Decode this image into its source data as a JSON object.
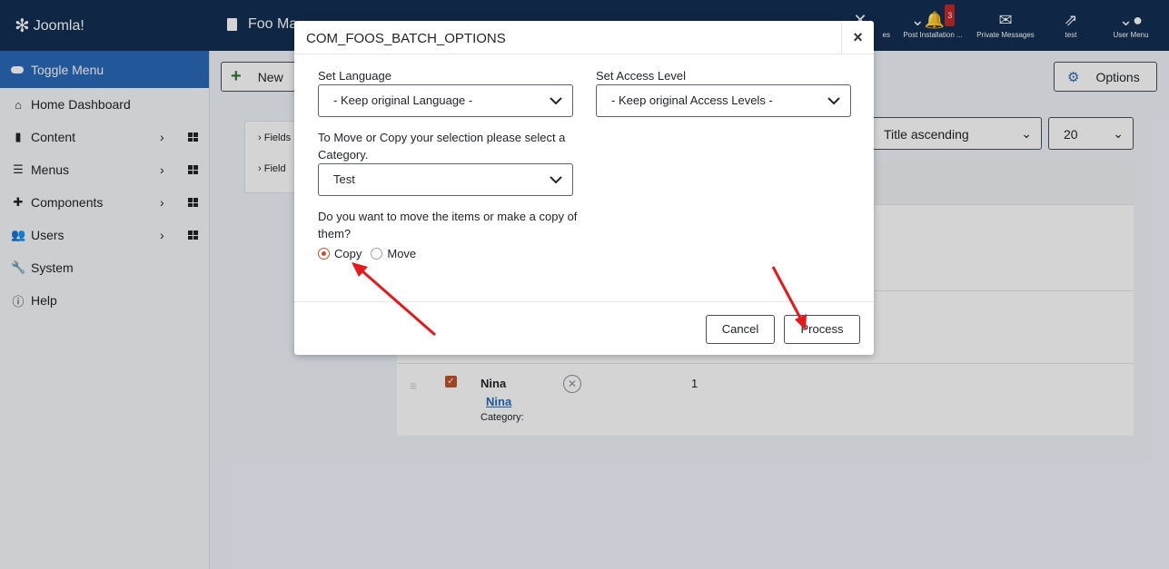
{
  "header": {
    "logo_text": "Joomla!",
    "page_title": "Foo Ma",
    "items": [
      {
        "icon": "x-icon",
        "label": "es"
      },
      {
        "icon": "bell-icon",
        "label": "Post Installation ...",
        "badge": "3"
      },
      {
        "icon": "envelope-icon",
        "label": "Private Messages"
      },
      {
        "icon": "external-link-icon",
        "label": "test"
      },
      {
        "icon": "user-icon",
        "label": "User Menu"
      }
    ]
  },
  "sidebar": {
    "toggle_label": "Toggle Menu",
    "items": [
      {
        "label": "Home Dashboard",
        "icon": "home-icon"
      },
      {
        "label": "Content",
        "icon": "file-icon"
      },
      {
        "label": "Menus",
        "icon": "list-icon"
      },
      {
        "label": "Components",
        "icon": "puzzle-icon"
      },
      {
        "label": "Users",
        "icon": "users-icon"
      },
      {
        "label": "System",
        "icon": "wrench-icon"
      },
      {
        "label": "Help",
        "icon": "info-icon"
      }
    ]
  },
  "toolbar": {
    "new_label": "New",
    "options_label": "Options"
  },
  "filters": {
    "field1": "Fields",
    "field2": "Field"
  },
  "list": {
    "ordering": "Title ascending",
    "limit": "20",
    "row": {
      "title": "Nina",
      "alias": "Nina",
      "category_label": "Category:",
      "count": "1"
    }
  },
  "modal": {
    "title": "COM_FOOS_BATCH_OPTIONS",
    "close": "×",
    "language_label": "Set Language",
    "language_value": "- Keep original Language -",
    "access_label": "Set Access Level",
    "access_value": "- Keep original Access Levels -",
    "category_label": "To Move or Copy your selection please select a Category.",
    "category_value": "Test",
    "move_copy_label": "Do you want to move the items or make a copy of them?",
    "copy_label": "Copy",
    "move_label": "Move",
    "cancel_label": "Cancel",
    "process_label": "Process"
  },
  "colors": {
    "header_bg": "#132f53",
    "accent": "#2a69b8",
    "radio_selected": "#c0542b",
    "arrow": "#e3191b"
  }
}
